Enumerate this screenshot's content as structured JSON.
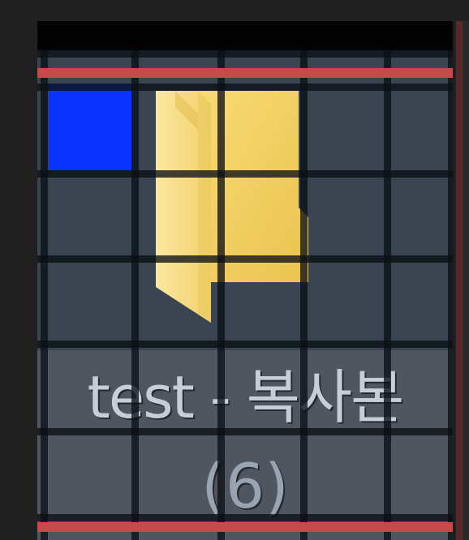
{
  "file_item": {
    "name": "test - 복사본",
    "count": "(6)",
    "icon": "folder-icon",
    "selection_swatch": "blue-selection-block"
  },
  "colors": {
    "tile_background": "#3a4551",
    "label_background": "#4f5660",
    "grid_lines": "#0c1014",
    "red_guides": "#c64a4a",
    "selection_blue": "#0b33ff",
    "folder_yellow": "#f2cf63"
  }
}
